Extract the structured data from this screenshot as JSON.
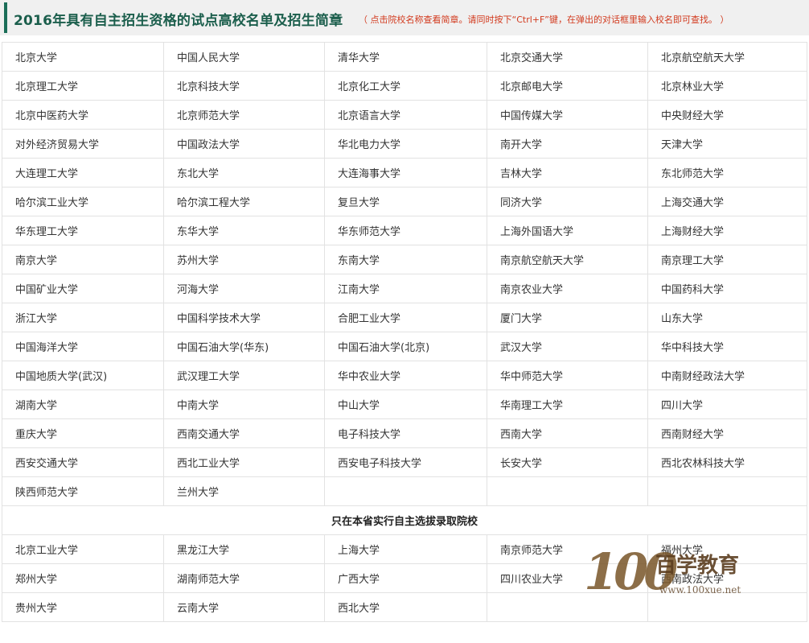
{
  "header": {
    "title": "2016年具有自主招生资格的试点高校名单及招生简章",
    "note": "（ 点击院校名称查看简章。请同时按下“Ctrl+F”键，在弹出的对话框里输入校名即可查找。 ）"
  },
  "colors": {
    "title": "#1b5e4c",
    "accent_bar": "#1b6e58",
    "note": "#d23a1e",
    "border": "#e2e2e2"
  },
  "pilot_schools": [
    [
      "北京大学",
      "中国人民大学",
      "清华大学",
      "北京交通大学",
      "北京航空航天大学"
    ],
    [
      "北京理工大学",
      "北京科技大学",
      "北京化工大学",
      "北京邮电大学",
      "北京林业大学"
    ],
    [
      "北京中医药大学",
      "北京师范大学",
      "北京语言大学",
      "中国传媒大学",
      "中央财经大学"
    ],
    [
      "对外经济贸易大学",
      "中国政法大学",
      "华北电力大学",
      "南开大学",
      "天津大学"
    ],
    [
      "大连理工大学",
      "东北大学",
      "大连海事大学",
      "吉林大学",
      "东北师范大学"
    ],
    [
      "哈尔滨工业大学",
      "哈尔滨工程大学",
      "复旦大学",
      "同济大学",
      "上海交通大学"
    ],
    [
      "华东理工大学",
      "东华大学",
      "华东师范大学",
      "上海外国语大学",
      "上海财经大学"
    ],
    [
      "南京大学",
      "苏州大学",
      "东南大学",
      "南京航空航天大学",
      "南京理工大学"
    ],
    [
      "中国矿业大学",
      "河海大学",
      "江南大学",
      "南京农业大学",
      "中国药科大学"
    ],
    [
      "浙江大学",
      "中国科学技术大学",
      "合肥工业大学",
      "厦门大学",
      "山东大学"
    ],
    [
      "中国海洋大学",
      "中国石油大学(华东)",
      "中国石油大学(北京)",
      "武汉大学",
      "华中科技大学"
    ],
    [
      "中国地质大学(武汉)",
      "武汉理工大学",
      "华中农业大学",
      "华中师范大学",
      "中南财经政法大学"
    ],
    [
      "湖南大学",
      "中南大学",
      "中山大学",
      "华南理工大学",
      "四川大学"
    ],
    [
      "重庆大学",
      "西南交通大学",
      "电子科技大学",
      "西南大学",
      "西南财经大学"
    ],
    [
      "西安交通大学",
      "西北工业大学",
      "西安电子科技大学",
      "长安大学",
      "西北农林科技大学"
    ],
    [
      "陕西师范大学",
      "兰州大学",
      "",
      "",
      ""
    ]
  ],
  "provincial_section": {
    "title": "只在本省实行自主选拔录取院校",
    "schools": [
      [
        "北京工业大学",
        "黑龙江大学",
        "上海大学",
        "南京师范大学",
        "福州大学"
      ],
      [
        "郑州大学",
        "湖南师范大学",
        "广西大学",
        "四川农业大学",
        "西南政法大学"
      ],
      [
        "贵州大学",
        "云南大学",
        "西北大学",
        "",
        ""
      ]
    ]
  },
  "watermark": {
    "number": "100",
    "brand": "百学教育",
    "url": "www.100xue.net"
  }
}
